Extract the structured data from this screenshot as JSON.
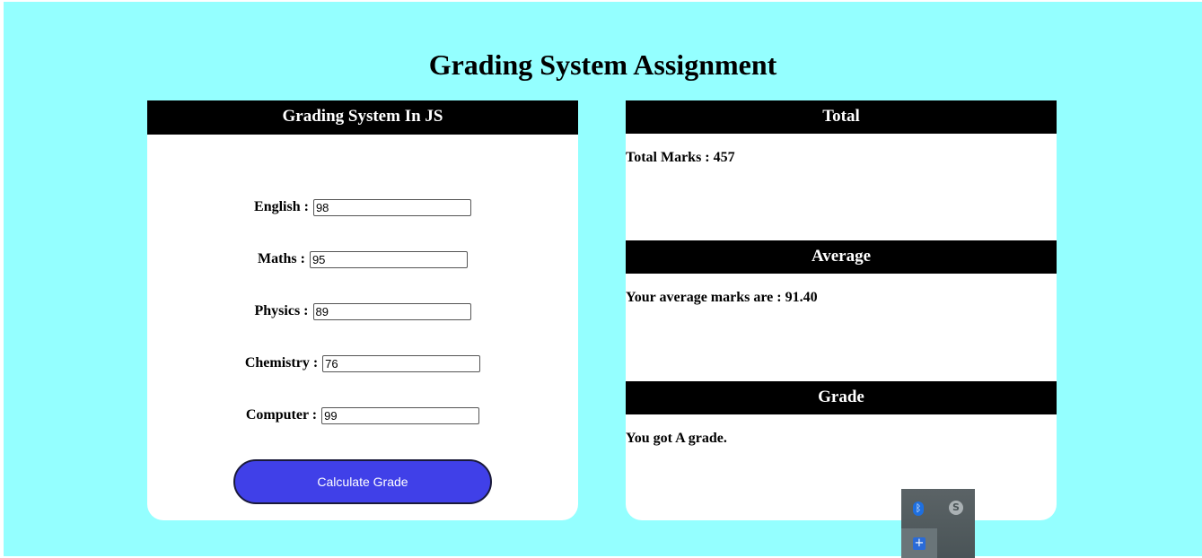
{
  "page": {
    "title": "Grading System Assignment",
    "background_color": "#94ffff"
  },
  "form": {
    "header": "Grading System In JS",
    "fields": [
      {
        "label": "English :",
        "value": "98"
      },
      {
        "label": "Maths :",
        "value": "95"
      },
      {
        "label": "Physics :",
        "value": "89"
      },
      {
        "label": "Chemistry :",
        "value": "76"
      },
      {
        "label": "Computer :",
        "value": "99"
      }
    ],
    "button_label": "Calculate Grade",
    "button_color": "#4040e8"
  },
  "results": {
    "total": {
      "header": "Total",
      "text": "Total Marks : 457"
    },
    "average": {
      "header": "Average",
      "text": "Your average marks are : 91.40"
    },
    "grade": {
      "header": "Grade",
      "text": "You got A grade."
    }
  },
  "tray": {
    "icons": [
      "bluetooth-icon",
      "skype-icon",
      "add-icon"
    ]
  }
}
